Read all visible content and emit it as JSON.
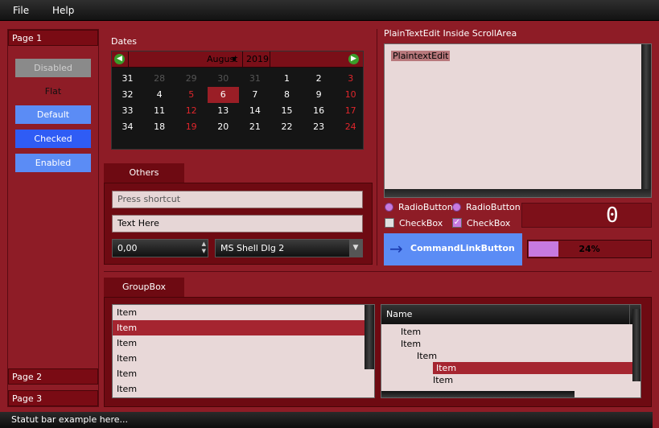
{
  "menubar": {
    "file": "File",
    "help": "Help"
  },
  "toolbox": {
    "page1": "Page 1",
    "page2": "Page 2",
    "page3": "Page 3",
    "buttons": {
      "disabled": "Disabled",
      "flat": "Flat",
      "default": "Default",
      "checked": "Checked",
      "enabled": "Enabled"
    }
  },
  "dates": {
    "title": "Dates",
    "month": "August",
    "year": "2019",
    "weeks": [
      "31",
      "32",
      "33",
      "34"
    ],
    "rows": [
      [
        "29",
        "30",
        "31",
        "1",
        "2",
        "3"
      ],
      [
        "4",
        "5",
        "6",
        "7",
        "8",
        "9",
        "10"
      ],
      [
        "11",
        "12",
        "13",
        "14",
        "15",
        "16",
        "17"
      ],
      [
        "18",
        "19",
        "20",
        "21",
        "22",
        "23",
        "24"
      ]
    ],
    "row0_first": "28",
    "selected": "6",
    "colors": {
      "selected": "#9a1e26",
      "weekend": "#e0262c",
      "other_month": "#555555"
    }
  },
  "others": {
    "tab": "Others",
    "shortcut_placeholder": "Press shortcut",
    "text_value": "Text Here",
    "spin_value": "0,00",
    "font_value": "MS Shell Dlg 2"
  },
  "plaintext": {
    "title": "PlainTextEdit Inside ScrollArea",
    "content": "PlaintextEdit"
  },
  "controls": {
    "radio1": "RadioButton",
    "radio2": "RadioButton",
    "check1": "CheckBox",
    "check2": "CheckBox",
    "lcd": "0",
    "command_link": "CommandLinkButton",
    "progress": 24,
    "progress_label": "24%"
  },
  "groupbox": {
    "tab": "GroupBox",
    "list_items": [
      "Item",
      "Item",
      "Item",
      "Item",
      "Item",
      "Item"
    ],
    "tree_header": "Name",
    "tree_items": [
      "Item",
      "Item",
      "Item",
      "Item",
      "Item"
    ]
  },
  "status": "Statut bar example here...",
  "colors": {
    "accent": "#5b8cf5",
    "checked": "#2f5cf5",
    "background": "#8e1c26",
    "selection": "#a52530"
  }
}
